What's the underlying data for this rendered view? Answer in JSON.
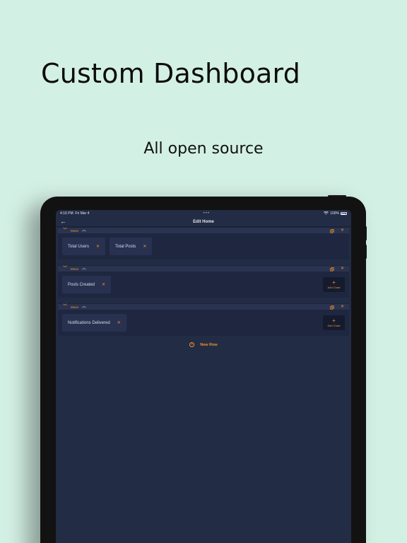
{
  "headline": "Custom Dashboard",
  "subline": "All open source",
  "status": {
    "time": "4:16 PM",
    "date": "Fri Mar 4",
    "battery": "100%"
  },
  "nav": {
    "title": "Edit Home"
  },
  "row_labels": {
    "move": "Move",
    "add_chart": "Add Chart"
  },
  "rows": [
    {
      "charts": [
        "Total Users",
        "Total Posts"
      ]
    },
    {
      "charts": [
        "Posts Created"
      ]
    },
    {
      "charts": [
        "Notifications Delivered"
      ]
    }
  ],
  "new_row_label": "New Row",
  "colors": {
    "background": "#d3f0e5",
    "screen": "#232c45",
    "accent": "#f0932b"
  }
}
